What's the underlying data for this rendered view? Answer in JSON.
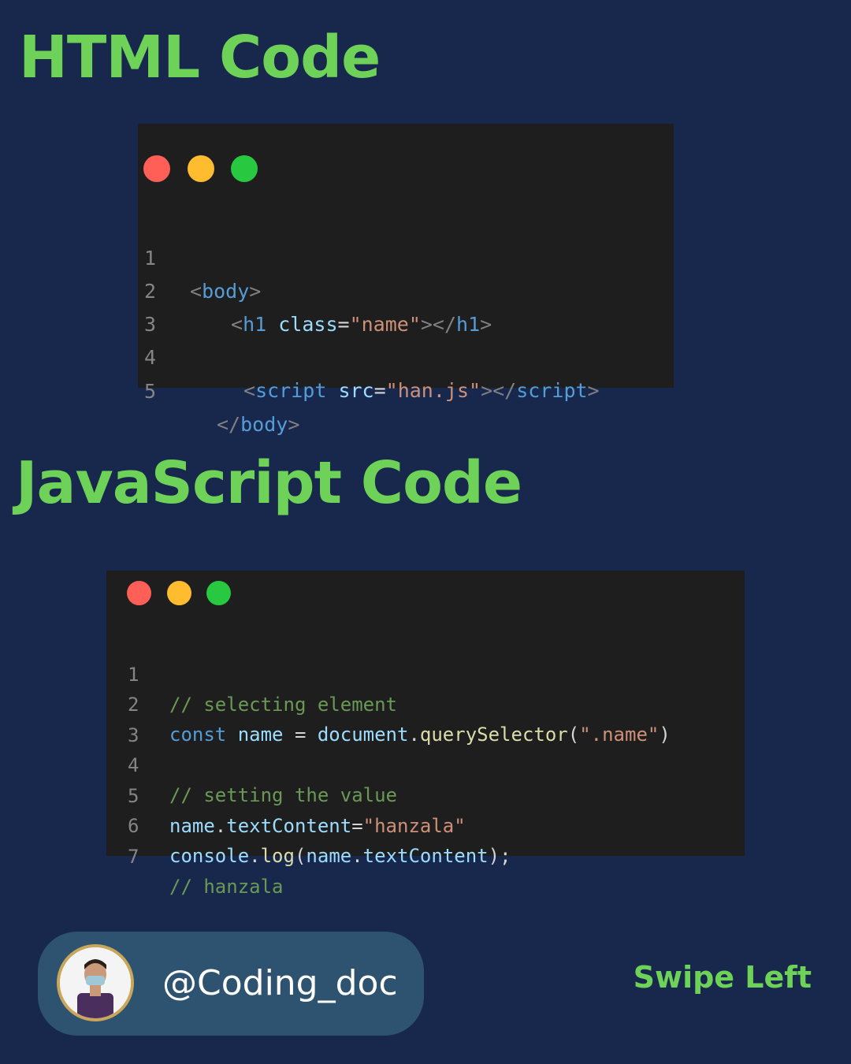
{
  "headings": {
    "html": "HTML Code",
    "js": "JavaScript Code"
  },
  "html_code": {
    "lines": [
      {
        "num": "1",
        "tokens": [
          [
            "punc",
            "<"
          ],
          [
            "tag",
            "body"
          ],
          [
            "punc",
            ">"
          ]
        ]
      },
      {
        "num": "2",
        "tokens": [
          [
            "punc",
            "<"
          ],
          [
            "tag",
            "h1"
          ],
          [
            "op",
            " "
          ],
          [
            "attr",
            "class"
          ],
          [
            "op",
            "="
          ],
          [
            "str",
            "\"name\""
          ],
          [
            "punc",
            "></"
          ],
          [
            "tag",
            "h1"
          ],
          [
            "punc",
            ">"
          ]
        ]
      },
      {
        "num": "3",
        "tokens": []
      },
      {
        "num": "4",
        "tokens": [
          [
            "punc",
            "<"
          ],
          [
            "tag",
            "script"
          ],
          [
            "op",
            " "
          ],
          [
            "attr",
            "src"
          ],
          [
            "op",
            "="
          ],
          [
            "str",
            "\"han.js\""
          ],
          [
            "punc",
            "></"
          ],
          [
            "tag",
            "script"
          ],
          [
            "punc",
            ">"
          ]
        ]
      },
      {
        "num": "5",
        "tokens": [
          [
            "punc",
            "</"
          ],
          [
            "tag",
            "body"
          ],
          [
            "punc",
            ">"
          ]
        ]
      }
    ]
  },
  "js_code": {
    "lines": [
      {
        "num": "1",
        "tokens": [
          [
            "cmt",
            "// selecting element"
          ]
        ]
      },
      {
        "num": "2",
        "tokens": [
          [
            "kw",
            "const"
          ],
          [
            "op",
            " "
          ],
          [
            "var",
            "name"
          ],
          [
            "op",
            " = "
          ],
          [
            "var",
            "document"
          ],
          [
            "op",
            "."
          ],
          [
            "fn",
            "querySelector"
          ],
          [
            "op",
            "("
          ],
          [
            "str",
            "\".name\""
          ],
          [
            "op",
            ")"
          ]
        ]
      },
      {
        "num": "3",
        "tokens": []
      },
      {
        "num": "4",
        "tokens": [
          [
            "cmt",
            "// setting the value"
          ]
        ]
      },
      {
        "num": "5",
        "tokens": [
          [
            "var",
            "name"
          ],
          [
            "op",
            "."
          ],
          [
            "var",
            "textContent"
          ],
          [
            "op",
            "="
          ],
          [
            "str",
            "\"hanzala\""
          ]
        ]
      },
      {
        "num": "6",
        "tokens": [
          [
            "var",
            "console"
          ],
          [
            "op",
            "."
          ],
          [
            "fn",
            "log"
          ],
          [
            "op",
            "("
          ],
          [
            "var",
            "name"
          ],
          [
            "op",
            "."
          ],
          [
            "var",
            "textContent"
          ],
          [
            "op",
            ");"
          ]
        ]
      },
      {
        "num": "7",
        "tokens": [
          [
            "cmt",
            "// hanzala"
          ]
        ]
      }
    ]
  },
  "profile": {
    "handle": "@Coding_doc"
  },
  "swipe_label": "Swipe Left",
  "colors": {
    "background": "#18284c",
    "accent": "#6ed158",
    "code_bg": "#1e1e1e",
    "pill": "#2e5370"
  }
}
